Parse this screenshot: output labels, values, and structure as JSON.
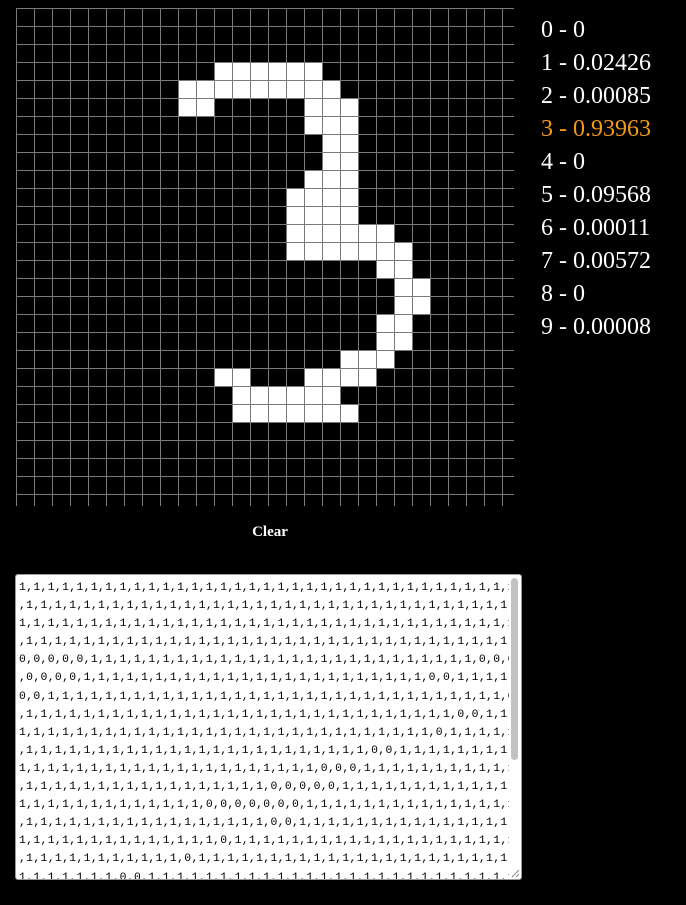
{
  "canvas": {
    "rows": 28,
    "cols": 28,
    "colors": {
      "on": "#ffffff",
      "off": "#000000",
      "grid_line": "#7a7a7a"
    },
    "pixels": [
      "0000000000000000000000000000",
      "0000000000000000000000000000",
      "0000000000000000000000000000",
      "0000000000011111100000000000",
      "0000000001111111110000000000",
      "0000000001100000111000000000",
      "0000000000000000111000000000",
      "0000000000000000011000000000",
      "0000000000000000011000000000",
      "0000000000000000111000000000",
      "0000000000000001111000000000",
      "0000000000000001111000000000",
      "0000000000000001111110000000",
      "0000000000000001111111000000",
      "0000000000000000000011000000",
      "0000000000000000000001100000",
      "0000000000000000000001100000",
      "0000000000000000000011000000",
      "0000000000000000000011000000",
      "0000000000000000001110000000",
      "0000000000011000111100000000",
      "0000000000001111110000000000",
      "0000000000001111111000000000",
      "0000000000000000000000000000",
      "0000000000000000000000000000",
      "0000000000000000000000000000",
      "0000000000000000000000000000",
      "0000000000000000000000000000"
    ]
  },
  "predictions": [
    {
      "label": "0 - 0",
      "top": false
    },
    {
      "label": "1 - 0.02426",
      "top": false
    },
    {
      "label": "2 - 0.00085",
      "top": false
    },
    {
      "label": "3 - 0.93963",
      "top": true
    },
    {
      "label": "4 - 0",
      "top": false
    },
    {
      "label": "5 - 0.09568",
      "top": false
    },
    {
      "label": "6 - 0.00011",
      "top": false
    },
    {
      "label": "7 - 0.00572",
      "top": false
    },
    {
      "label": "8 - 0",
      "top": false
    },
    {
      "label": "9 - 0.00008",
      "top": false
    }
  ],
  "colors": {
    "highlight": "#f29a1e",
    "text": "#ffffff",
    "background": "#000000"
  },
  "clear_button": {
    "label": "Clear"
  },
  "output": {
    "lines": [
      "1,1,1,1,1,1,1,1,1,1,1,1,1,1,1,1,1,1,1,1,1,1,1,1,1,1,1,1,1,1,1,1,1,1,1,1,1",
      ",1,1,1,1,1,1,1,1,1,1,1,1,1,1,1,1,1,1,1,1,1,1,1,1,1,1,1,1,1,1,1,1,1,1,1,1,",
      "1,1,1,1,1,1,1,1,1,1,1,1,1,1,1,1,1,1,1,1,1,1,1,1,1,1,1,1,1,1,1,1,1,1,1,1,1",
      ",1,1,1,1,1,1,1,1,1,1,1,1,1,1,1,1,1,1,1,1,1,1,1,1,1,1,1,1,1,1,1,1,1,1,1,0,",
      "0,0,0,0,0,1,1,1,1,1,1,1,1,1,1,1,1,1,1,1,1,1,1,1,1,1,1,1,1,1,1,1,0,0,0,0,0",
      ",0,0,0,0,1,1,1,1,1,1,1,1,1,1,1,1,1,1,1,1,1,1,1,1,1,1,1,1,0,0,1,1,1,1,1,0,",
      "0,0,1,1,1,1,1,1,1,1,1,1,1,1,1,1,1,1,1,1,1,1,1,1,1,1,1,1,1,1,1,1,1,1,0,0,1",
      ",1,1,1,1,1,1,1,1,1,1,1,1,1,1,1,1,1,1,1,1,1,1,1,1,1,1,1,1,1,1,0,0,1,1,1,1,",
      "1,1,1,1,1,1,1,1,1,1,1,1,1,1,1,1,1,1,1,1,1,1,1,1,1,1,1,1,1,0,1,1,1,1,1,1,1",
      ",1,1,1,1,1,1,1,1,1,1,1,1,1,1,1,1,1,1,1,1,1,1,1,1,0,0,1,1,1,1,1,1,1,1,1,1,",
      "1,1,1,1,1,1,1,1,1,1,1,1,1,1,1,1,1,1,1,1,1,0,0,0,1,1,1,1,1,1,1,1,1,1,1,1,1",
      ",1,1,1,1,1,1,1,1,1,1,1,1,1,1,1,1,1,0,0,0,0,0,1,1,1,1,1,1,1,1,1,1,1,1,1,1,",
      "1,1,1,1,1,1,1,1,1,1,1,1,1,0,0,0,0,0,0,0,1,1,1,1,1,1,1,1,1,1,1,1,1,1,1,1,1",
      ",1,1,1,1,1,1,1,1,1,1,1,1,1,1,1,1,1,0,0,1,1,1,1,1,1,1,1,1,1,1,1,1,1,1,1,1,",
      "1,1,1,1,1,1,1,1,1,1,1,1,1,1,0,1,1,1,1,1,1,1,1,1,1,1,1,1,1,1,1,1,1,1,1,1,1",
      ",1,1,1,1,1,1,1,1,1,1,1,0,1,1,1,1,1,1,1,1,1,1,1,1,1,1,1,1,1,1,1,1,1,1,1,1,",
      "1,1,1,1,1,1,1,0,0,1,1,1,1,1,1,1,1,1,1,1,1,1,1,1,1,1,1,1,1,1,1,1,1,1,1,1,1",
      ",1,1,1,0,1,1,1,1,1,1,1,1,1,1,1,1,1,1,1,1,1,1,1,1,1,1,1,1,1,1,1,1,1,1,1,1,"
    ]
  }
}
